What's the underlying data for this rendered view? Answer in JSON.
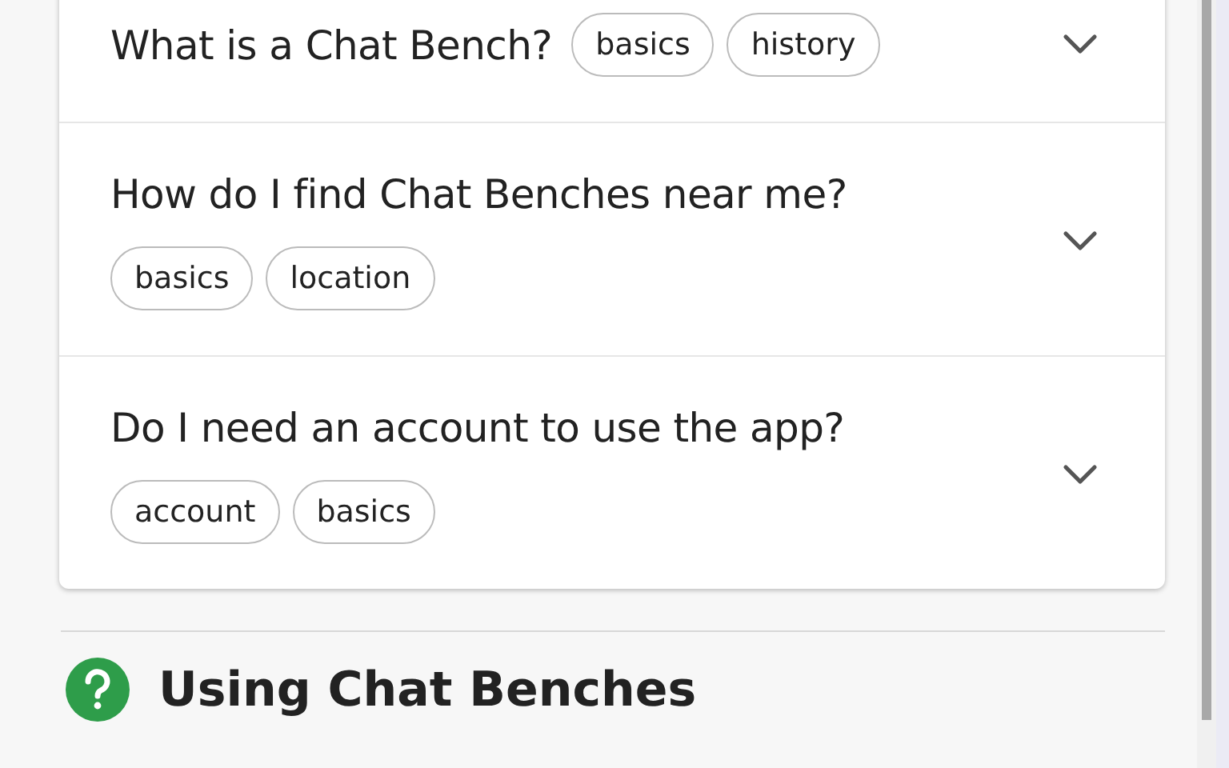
{
  "faq_items": [
    {
      "question": "What is a Chat Bench?",
      "tags": [
        "basics",
        "history"
      ],
      "expanded": false
    },
    {
      "question": "How do I find Chat Benches near me?",
      "tags": [
        "basics",
        "location"
      ],
      "expanded": false
    },
    {
      "question": "Do I need an account to use the app?",
      "tags": [
        "account",
        "basics"
      ],
      "expanded": false
    }
  ],
  "next_section": {
    "title": "Using Chat Benches"
  }
}
